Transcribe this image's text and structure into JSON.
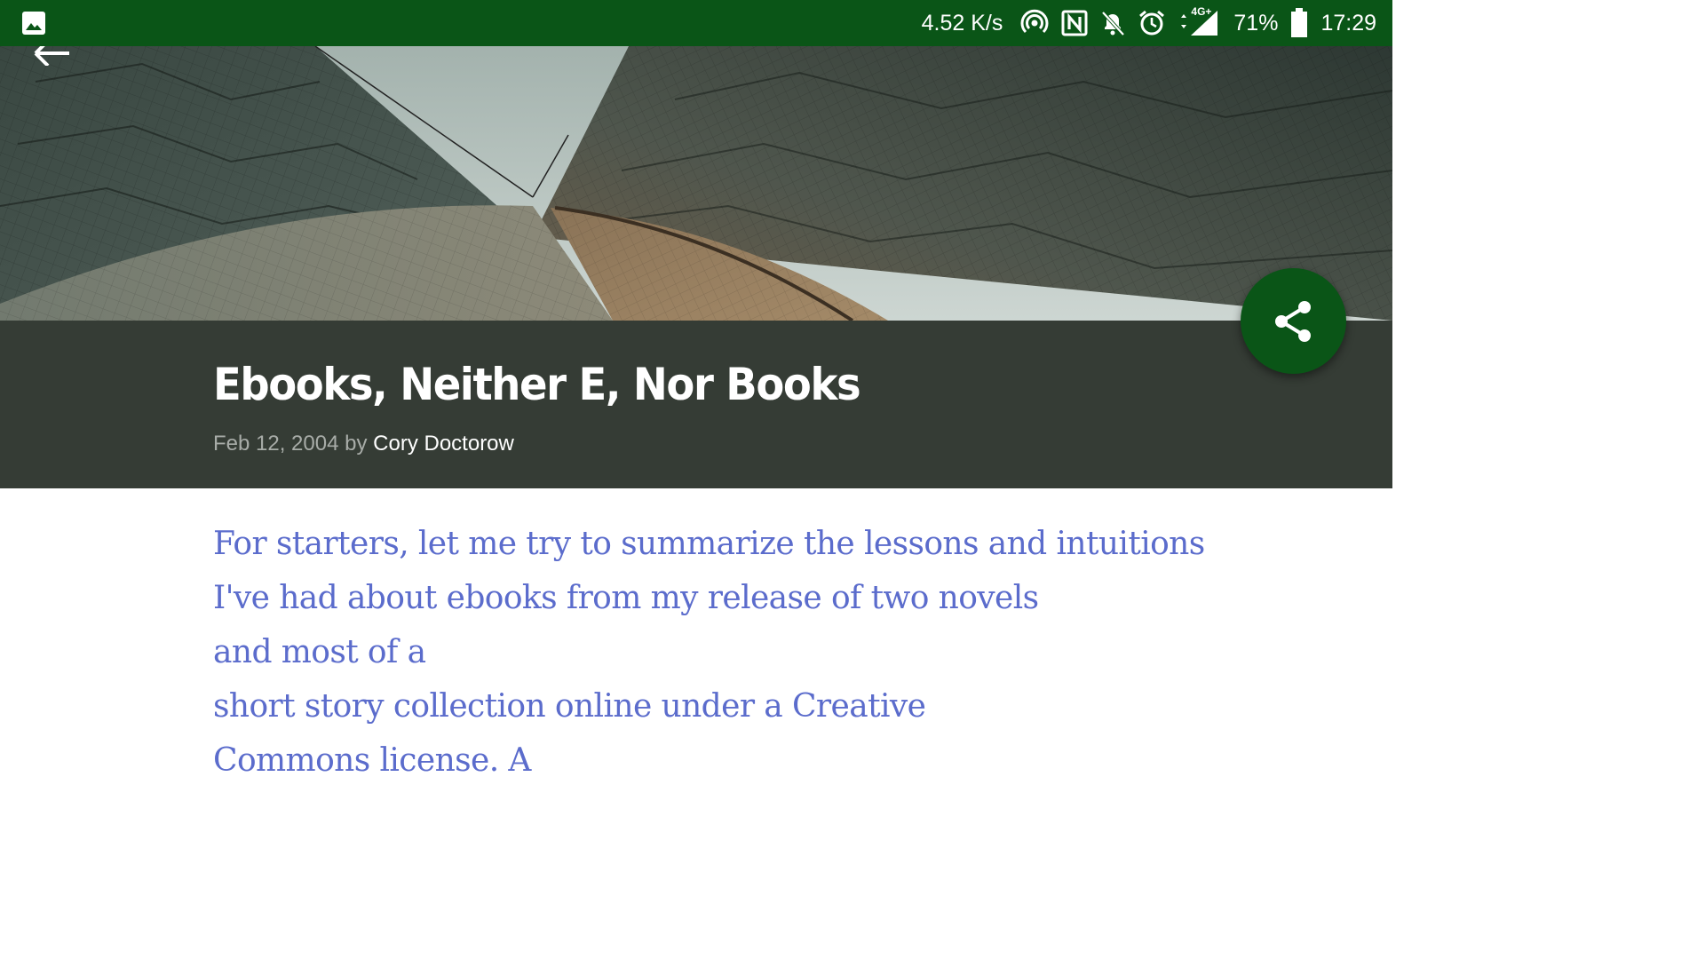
{
  "status_bar": {
    "net_speed": "4.52 K/s",
    "network_type": "4G+",
    "battery": "71%",
    "time": "17:29",
    "icons": [
      "image-notification-icon",
      "hotspot-icon",
      "nfc-icon",
      "notifications-off-icon",
      "alarm-icon",
      "data-arrows-icon",
      "signal-icon",
      "battery-icon"
    ]
  },
  "colors": {
    "status_bar_bg": "#0a5517",
    "title_band_bg": "#353c35",
    "fab_bg": "#0a5517",
    "body_text": "#5b6ccc"
  },
  "post": {
    "title": "Ebooks, Neither E, Nor Books",
    "date": "Feb 12, 2004",
    "by": "by",
    "author": "Cory Doctorow"
  },
  "article": {
    "lines": [
      "For starters, let me try to summarize the lessons and intuitions",
      "I've had about ebooks from my release of two novels",
      "and most of a",
      "short story collection online under a Creative",
      "Commons license. A"
    ]
  },
  "actions": {
    "share_icon": "share-icon",
    "back_icon": "back-arrow-icon"
  }
}
